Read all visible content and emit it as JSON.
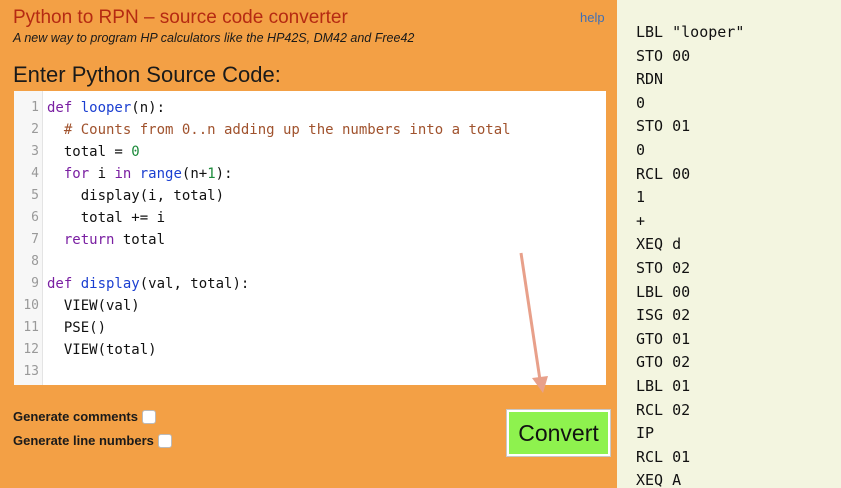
{
  "app": {
    "title": "Python to RPN – source code converter",
    "subtitle": "A new way to program HP calculators like the HP42S, DM42 and Free42",
    "help": "help",
    "heading": "Enter Python Source Code:"
  },
  "editor": {
    "lines": [
      {
        "n": "1",
        "t": [
          [
            "kw",
            "def "
          ],
          [
            "fn",
            "looper"
          ],
          [
            "txt",
            "(n):"
          ]
        ]
      },
      {
        "n": "2",
        "t": [
          [
            "txt",
            "  "
          ],
          [
            "cm",
            "# Counts from 0..n adding up the numbers into a total"
          ]
        ]
      },
      {
        "n": "3",
        "t": [
          [
            "txt",
            "  total = "
          ],
          [
            "num",
            "0"
          ]
        ]
      },
      {
        "n": "4",
        "t": [
          [
            "txt",
            "  "
          ],
          [
            "kw",
            "for"
          ],
          [
            "txt",
            " i "
          ],
          [
            "kw",
            "in"
          ],
          [
            "txt",
            " "
          ],
          [
            "fn",
            "range"
          ],
          [
            "txt",
            "(n+"
          ],
          [
            "num",
            "1"
          ],
          [
            "txt",
            "):"
          ]
        ]
      },
      {
        "n": "5",
        "t": [
          [
            "txt",
            "    display(i, total)"
          ]
        ]
      },
      {
        "n": "6",
        "t": [
          [
            "txt",
            "    total += i"
          ]
        ]
      },
      {
        "n": "7",
        "t": [
          [
            "txt",
            "  "
          ],
          [
            "kw",
            "return"
          ],
          [
            "txt",
            " total"
          ]
        ]
      },
      {
        "n": "8",
        "t": []
      },
      {
        "n": "9",
        "t": [
          [
            "kw",
            "def "
          ],
          [
            "fn",
            "display"
          ],
          [
            "txt",
            "(val, total):"
          ]
        ]
      },
      {
        "n": "10",
        "t": [
          [
            "txt",
            "  VIEW(val)"
          ]
        ]
      },
      {
        "n": "11",
        "t": [
          [
            "txt",
            "  PSE()"
          ]
        ]
      },
      {
        "n": "12",
        "t": [
          [
            "txt",
            "  VIEW(total)"
          ]
        ]
      },
      {
        "n": "13",
        "t": []
      }
    ]
  },
  "options": {
    "comments_label": "Generate comments",
    "comments_checked": false,
    "line_numbers_label": "Generate line numbers",
    "line_numbers_checked": false
  },
  "convert_label": "Convert",
  "output": [
    "LBL \"looper\"",
    "STO 00",
    "RDN",
    "0",
    "STO 01",
    "0",
    "RCL 00",
    "1",
    "+",
    "XEQ d",
    "STO 02",
    "LBL 00",
    "ISG 02",
    "GTO 01",
    "GTO 02",
    "LBL 01",
    "RCL 02",
    "IP",
    "RCL 01",
    "XEQ A"
  ]
}
